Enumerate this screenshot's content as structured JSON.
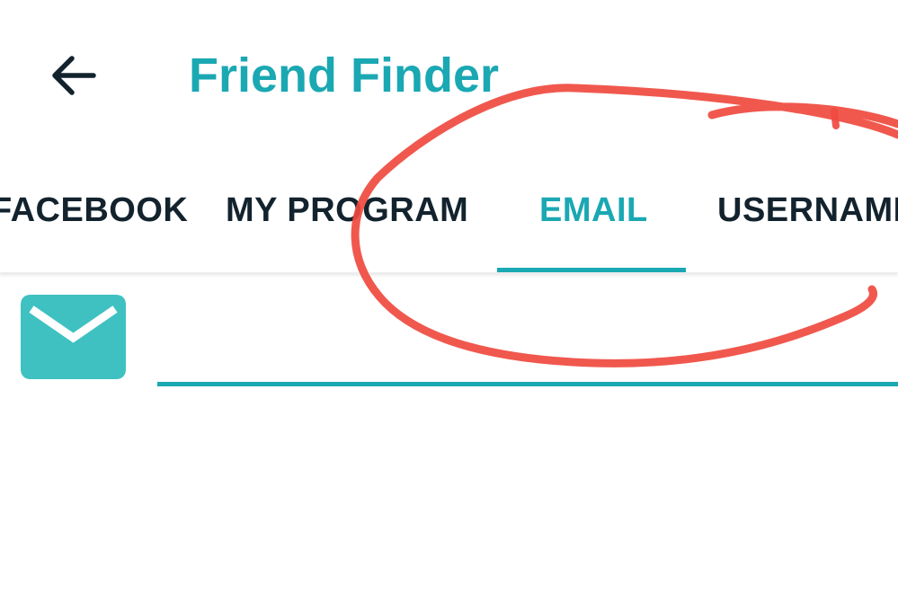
{
  "colors": {
    "accent": "#1aa8b3",
    "tab_text": "#13232e",
    "mail_icon_bg": "#3fc1c2",
    "annotation": "#ef4a3f"
  },
  "header": {
    "back_icon": "arrow-left-icon",
    "title": "Friend Finder"
  },
  "tabs": [
    {
      "label": "FACEBOOK",
      "selected": false
    },
    {
      "label": "MY PROGRAM",
      "selected": false
    },
    {
      "label": "EMAIL",
      "selected": true
    },
    {
      "label": "USERNAME",
      "selected": false
    }
  ],
  "email_search": {
    "icon": "envelope-icon",
    "value": "",
    "placeholder": ""
  }
}
